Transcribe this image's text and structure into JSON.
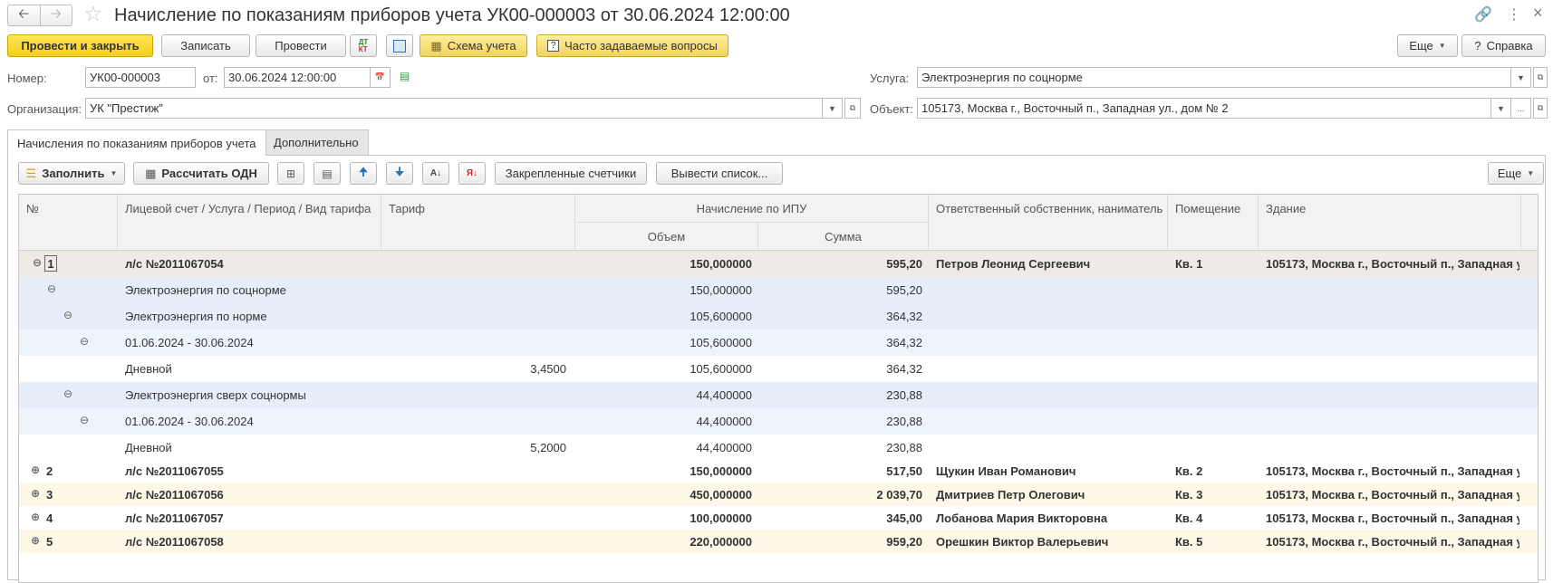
{
  "window": {
    "title": "Начисление по показаниям приборов учета УК00-000003 от 30.06.2024 12:00:00"
  },
  "toolbar": {
    "post_close": "Провести и закрыть",
    "save": "Записать",
    "post": "Провести",
    "scheme": "Схема учета",
    "faq": "Часто задаваемые вопросы",
    "more": "Еще",
    "help": "Справка"
  },
  "form": {
    "number_label": "Номер:",
    "number_value": "УК00-000003",
    "date_label": "от:",
    "date_value": "30.06.2024 12:00:00",
    "org_label": "Организация:",
    "org_value": "УК \"Престиж\"",
    "service_label": "Услуга:",
    "service_value": "Электроэнергия по соцнорме",
    "object_label": "Объект:",
    "object_value": "105173, Москва г., Восточный п., Западная ул., дом № 2"
  },
  "tabs": [
    {
      "label": "Начисления по показаниям приборов учета",
      "active": true
    },
    {
      "label": "Дополнительно",
      "active": false
    }
  ],
  "table_toolbar": {
    "fill": "Заполнить",
    "calc_odn": "Рассчитать ОДН",
    "pinned_meters": "Закрепленные счетчики",
    "export_list": "Вывести список...",
    "more": "Еще"
  },
  "table": {
    "headers": {
      "num": "№",
      "account": "Лицевой счет / Услуга / Период / Вид тарифа",
      "tariff": "Тариф",
      "ipu": "Начисление по ИПУ",
      "volume": "Объем",
      "sum": "Сумма",
      "owner": "Ответственный собственник, наниматель",
      "room": "Помещение",
      "building": "Здание"
    },
    "rows": [
      {
        "num": "1",
        "account": "л/с №2011067054",
        "tariff": "",
        "volume": "150,000000",
        "sum": "595,20",
        "owner": "Петров Леонид Сергеевич",
        "room": "Кв. 1",
        "building": "105173, Москва г., Восточный п., Западная у..."
      },
      {
        "num": "",
        "account": "Электроэнергия по соцнорме",
        "tariff": "",
        "volume": "150,000000",
        "sum": "595,20",
        "owner": "",
        "room": "",
        "building": ""
      },
      {
        "num": "",
        "account": "Электроэнергия по норме",
        "tariff": "",
        "volume": "105,600000",
        "sum": "364,32",
        "owner": "",
        "room": "",
        "building": ""
      },
      {
        "num": "",
        "account": "01.06.2024 - 30.06.2024",
        "tariff": "",
        "volume": "105,600000",
        "sum": "364,32",
        "owner": "",
        "room": "",
        "building": ""
      },
      {
        "num": "",
        "account": "Дневной",
        "tariff": "3,4500",
        "volume": "105,600000",
        "sum": "364,32",
        "owner": "",
        "room": "",
        "building": ""
      },
      {
        "num": "",
        "account": "Электроэнергия сверх соцнормы",
        "tariff": "",
        "volume": "44,400000",
        "sum": "230,88",
        "owner": "",
        "room": "",
        "building": ""
      },
      {
        "num": "",
        "account": "01.06.2024 - 30.06.2024",
        "tariff": "",
        "volume": "44,400000",
        "sum": "230,88",
        "owner": "",
        "room": "",
        "building": ""
      },
      {
        "num": "",
        "account": "Дневной",
        "tariff": "5,2000",
        "volume": "44,400000",
        "sum": "230,88",
        "owner": "",
        "room": "",
        "building": ""
      },
      {
        "num": "2",
        "account": "л/с №2011067055",
        "tariff": "",
        "volume": "150,000000",
        "sum": "517,50",
        "owner": "Щукин Иван Романович",
        "room": "Кв. 2",
        "building": "105173, Москва г., Восточный п., Западная у..."
      },
      {
        "num": "3",
        "account": "л/с №2011067056",
        "tariff": "",
        "volume": "450,000000",
        "sum": "2 039,70",
        "owner": "Дмитриев Петр Олегович",
        "room": "Кв. 3",
        "building": "105173, Москва г., Восточный п., Западная у..."
      },
      {
        "num": "4",
        "account": "л/с №2011067057",
        "tariff": "",
        "volume": "100,000000",
        "sum": "345,00",
        "owner": "Лобанова Мария Викторовна",
        "room": "Кв. 4",
        "building": "105173, Москва г., Восточный п., Западная у..."
      },
      {
        "num": "5",
        "account": "л/с №2011067058",
        "tariff": "",
        "volume": "220,000000",
        "sum": "959,20",
        "owner": "Орешкин Виктор Валерьевич",
        "room": "Кв. 5",
        "building": "105173, Москва г., Восточный п., Западная у..."
      }
    ]
  },
  "colors": {
    "accent_yellow": "#f5cf1a",
    "selected_row": "#eeebe6",
    "group_row": "#e6eef9",
    "alt_row": "#fdf8e8"
  },
  "icons": [
    "back-icon",
    "forward-icon",
    "star-icon",
    "link-icon",
    "menu-dots-icon",
    "close-icon",
    "calendar-icon",
    "doc-icon",
    "scheme-icon",
    "question-icon",
    "fill-icon",
    "calculator-icon",
    "add-row-icon",
    "add-group-icon",
    "move-up-icon",
    "move-down-icon",
    "sort-asc-icon",
    "sort-desc-icon"
  ]
}
